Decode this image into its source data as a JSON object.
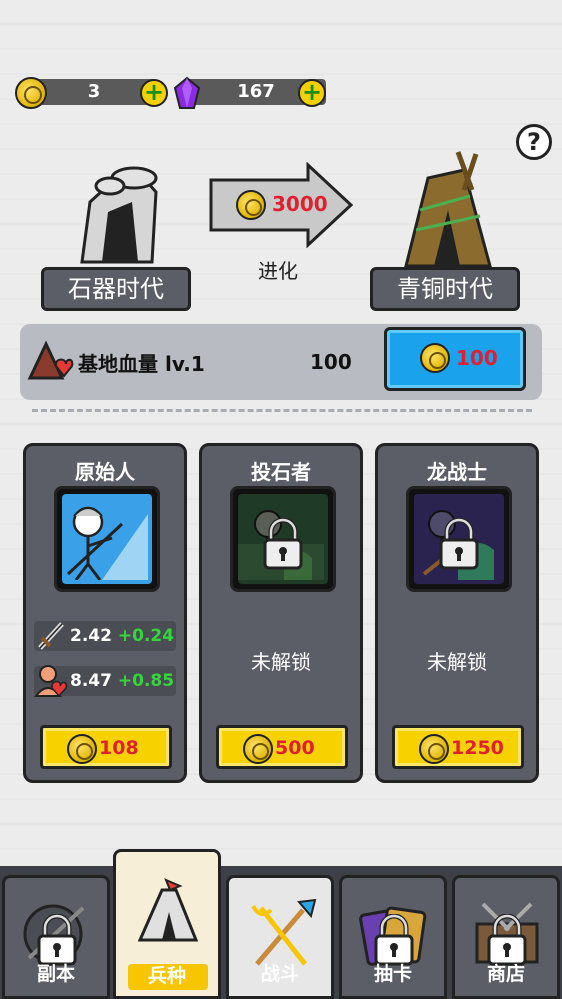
{
  "currency": {
    "coins": "3",
    "gems": "167",
    "add_icon": "plus-icon"
  },
  "help": "?",
  "evolution": {
    "current_era": "石器时代",
    "next_era": "青铜时代",
    "cost": "3000",
    "action": "进化"
  },
  "base_hp": {
    "title": "基地血量 lv.1",
    "value": "100",
    "upgrade_cost": "100"
  },
  "units": [
    {
      "name": "原始人",
      "locked": false,
      "attack": "2.42",
      "attack_plus": "+0.24",
      "health": "8.47",
      "health_plus": "+0.85",
      "cost": "108"
    },
    {
      "name": "投石者",
      "locked": true,
      "locked_label": "未解锁",
      "cost": "500"
    },
    {
      "name": "龙战士",
      "locked": true,
      "locked_label": "未解锁",
      "cost": "1250"
    }
  ],
  "nav": [
    {
      "label": "副本",
      "locked": true,
      "active": false
    },
    {
      "label": "兵种",
      "locked": false,
      "active": true
    },
    {
      "label": "战斗",
      "locked": false,
      "active": false
    },
    {
      "label": "抽卡",
      "locked": true,
      "active": false
    },
    {
      "label": "商店",
      "locked": true,
      "active": false
    }
  ],
  "colors": {
    "accent_yellow": "#f7d100",
    "accent_blue": "#1aa3ec",
    "cost_red": "#e02030",
    "bonus_green": "#34d63a",
    "panel_gray": "#5b5e66"
  }
}
